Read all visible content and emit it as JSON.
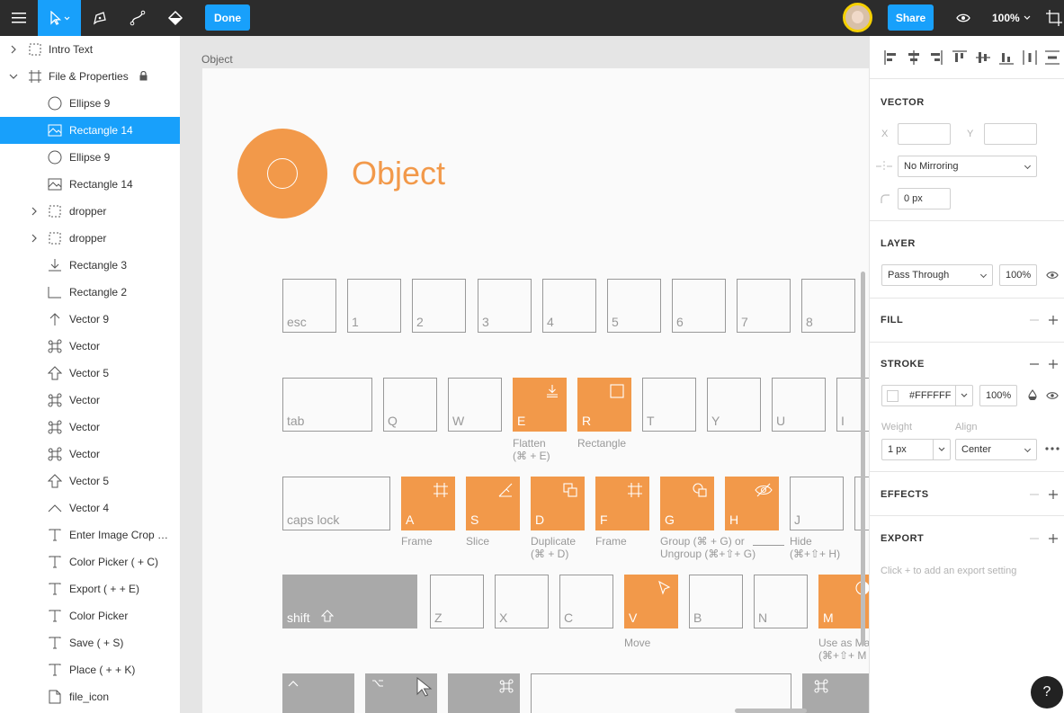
{
  "toolbar": {
    "menu_icon": "hamburger-icon",
    "move_tool_icon": "pointer-icon",
    "pen_tool_icon": "pen-icon",
    "pencil_tool_icon": "bezier-icon",
    "fill_tool_icon": "paint-bucket-icon",
    "done_label": "Done",
    "share_label": "Share",
    "preview_icon": "eye-icon",
    "zoom_label": "100%",
    "frame_icon": "crop-frame-icon",
    "accent_color": "#18a0fb"
  },
  "layers": [
    {
      "name": "Intro Text",
      "icon": "frame-dashed-icon",
      "indent": 0,
      "chevron": "right",
      "selected": false
    },
    {
      "name": "File & Properties",
      "icon": "frame-icon",
      "indent": 0,
      "chevron": "down",
      "selected": false,
      "locked": true
    },
    {
      "name": "Ellipse 9",
      "icon": "ellipse-icon",
      "indent": 1,
      "chevron": "",
      "selected": false
    },
    {
      "name": "Rectangle 14",
      "icon": "image-icon",
      "indent": 1,
      "chevron": "",
      "selected": true
    },
    {
      "name": "Ellipse 9",
      "icon": "ellipse-icon",
      "indent": 1,
      "chevron": "",
      "selected": false
    },
    {
      "name": "Rectangle 14",
      "icon": "image-icon",
      "indent": 1,
      "chevron": "",
      "selected": false
    },
    {
      "name": "dropper",
      "icon": "group-dashed-icon",
      "indent": 1,
      "chevron": "right",
      "selected": false
    },
    {
      "name": "dropper",
      "icon": "group-dashed-icon",
      "indent": 1,
      "chevron": "right",
      "selected": false
    },
    {
      "name": "Rectangle 3",
      "icon": "download-icon",
      "indent": 1,
      "chevron": "",
      "selected": false
    },
    {
      "name": "Rectangle 2",
      "icon": "corner-icon",
      "indent": 1,
      "chevron": "",
      "selected": false
    },
    {
      "name": "Vector 9",
      "icon": "arrow-up-icon",
      "indent": 1,
      "chevron": "",
      "selected": false
    },
    {
      "name": "Vector",
      "icon": "command-icon",
      "indent": 1,
      "chevron": "",
      "selected": false
    },
    {
      "name": "Vector 5",
      "icon": "shift-icon",
      "indent": 1,
      "chevron": "",
      "selected": false
    },
    {
      "name": "Vector",
      "icon": "command-icon",
      "indent": 1,
      "chevron": "",
      "selected": false
    },
    {
      "name": "Vector",
      "icon": "command-icon",
      "indent": 1,
      "chevron": "",
      "selected": false
    },
    {
      "name": "Vector",
      "icon": "command-icon",
      "indent": 1,
      "chevron": "",
      "selected": false
    },
    {
      "name": "Vector 5",
      "icon": "shift-icon",
      "indent": 1,
      "chevron": "",
      "selected": false
    },
    {
      "name": "Vector 4",
      "icon": "caret-up-icon",
      "indent": 1,
      "chevron": "",
      "selected": false
    },
    {
      "name": "Enter Image Crop Mod...",
      "icon": "text-icon",
      "indent": 1,
      "chevron": "",
      "selected": false
    },
    {
      "name": "Color Picker ( + C)",
      "icon": "text-icon",
      "indent": 1,
      "chevron": "",
      "selected": false
    },
    {
      "name": "Export ( + + E)",
      "icon": "text-icon",
      "indent": 1,
      "chevron": "",
      "selected": false
    },
    {
      "name": "Color Picker",
      "icon": "text-icon",
      "indent": 1,
      "chevron": "",
      "selected": false
    },
    {
      "name": "Save ( + S)",
      "icon": "text-icon",
      "indent": 1,
      "chevron": "",
      "selected": false
    },
    {
      "name": "Place ( + + K)",
      "icon": "text-icon",
      "indent": 1,
      "chevron": "",
      "selected": false
    },
    {
      "name": "file_icon",
      "icon": "file-icon",
      "indent": 1,
      "chevron": "",
      "selected": false
    }
  ],
  "canvas": {
    "frame_label": "Object",
    "title": "Object",
    "accent_color": "#f2994a",
    "keys": {
      "esc": "esc",
      "k1": "1",
      "k2": "2",
      "k3": "3",
      "k4": "4",
      "k5": "5",
      "k6": "6",
      "k7": "7",
      "k8": "8",
      "tab": "tab",
      "q": "Q",
      "w": "W",
      "e": "E",
      "r": "R",
      "t": "T",
      "y": "Y",
      "u": "U",
      "i": "I",
      "caps": "caps lock",
      "a": "A",
      "s": "S",
      "d": "D",
      "f": "F",
      "g": "G",
      "h": "H",
      "j": "J",
      "shift": "shift",
      "z": "Z",
      "x": "X",
      "c": "C",
      "v": "V",
      "b": "B",
      "n": "N",
      "m": "M",
      "control": "control",
      "option": "option",
      "command": "command",
      "command2": "command"
    },
    "captions": {
      "e": "Flatten\n(⌘ + E)",
      "r": "Rectangle",
      "a": "Frame",
      "s": "Slice",
      "d": "Duplicate\n(⌘ + D)",
      "f": "Frame",
      "g": "Group (⌘ + G) or\nUngroup (⌘+⇧+ G)",
      "h": "Hide\n(⌘+⇧+ H)",
      "v": "Move",
      "m": "Use as Mas\n(⌘+⇧+ M"
    }
  },
  "properties": {
    "vector": {
      "title": "VECTOR",
      "x_label": "X",
      "y_label": "Y",
      "x_value": "",
      "y_value": "",
      "mirroring": "No Mirroring",
      "corner_radius": "0 px"
    },
    "layer": {
      "title": "LAYER",
      "blend_mode": "Pass Through",
      "opacity": "100%"
    },
    "fill": {
      "title": "FILL"
    },
    "stroke": {
      "title": "STROKE",
      "color_hex": "#FFFFFF",
      "opacity": "100%",
      "weight_label": "Weight",
      "align_label": "Align",
      "weight_value": "1 px",
      "align_value": "Center"
    },
    "effects": {
      "title": "EFFECTS"
    },
    "export": {
      "title": "EXPORT",
      "hint": "Click + to add an export setting"
    },
    "help_label": "?"
  }
}
